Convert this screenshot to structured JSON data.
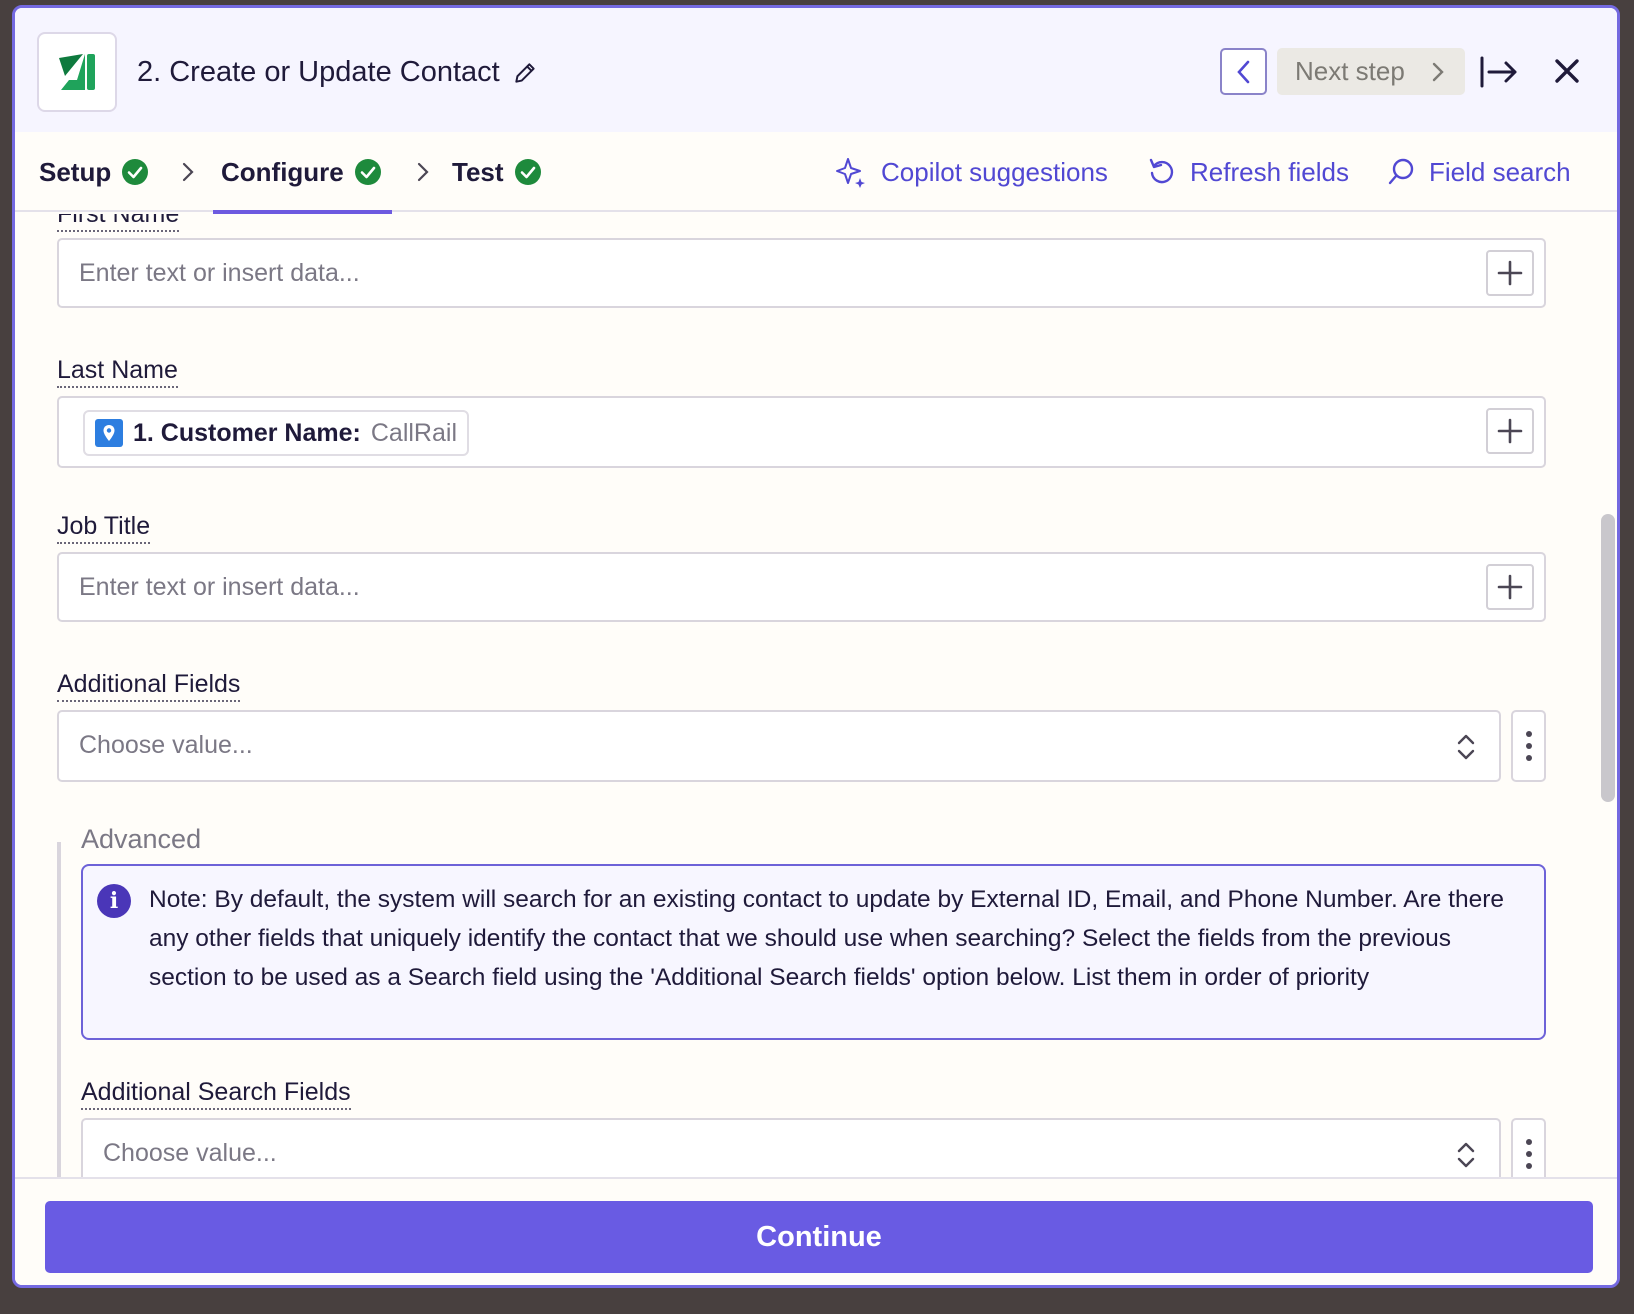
{
  "header": {
    "title": "2. Create or Update Contact",
    "next_step_label": "Next step"
  },
  "tabs": [
    {
      "label": "Setup",
      "status": "complete"
    },
    {
      "label": "Configure",
      "status": "complete",
      "active": true
    },
    {
      "label": "Test",
      "status": "complete"
    }
  ],
  "tools": {
    "copilot": "Copilot suggestions",
    "refresh": "Refresh fields",
    "search": "Field search"
  },
  "fields": {
    "first_name": {
      "label": "First Name",
      "placeholder": "Enter text or insert data..."
    },
    "last_name": {
      "label": "Last Name",
      "pill_step": "1. Customer Name:",
      "pill_value": "CallRail"
    },
    "job_title": {
      "label": "Job Title",
      "placeholder": "Enter text or insert data..."
    },
    "additional_fields": {
      "label": "Additional Fields",
      "placeholder": "Choose value..."
    }
  },
  "advanced": {
    "title": "Advanced",
    "note": "Note: By default, the system will search for an existing contact to update by External ID, Email, and Phone Number. Are there any other fields that uniquely identify the contact that we should use when searching? Select the fields from the previous section to be used as a Search field using the 'Additional Search fields' option below. List them in order of priority",
    "search_fields_label": "Additional Search Fields",
    "search_fields_placeholder": "Choose value..."
  },
  "footer": {
    "continue_label": "Continue"
  },
  "colors": {
    "accent": "#695be3",
    "success": "#1e8a3c",
    "brand_green": "#1fa35b"
  }
}
